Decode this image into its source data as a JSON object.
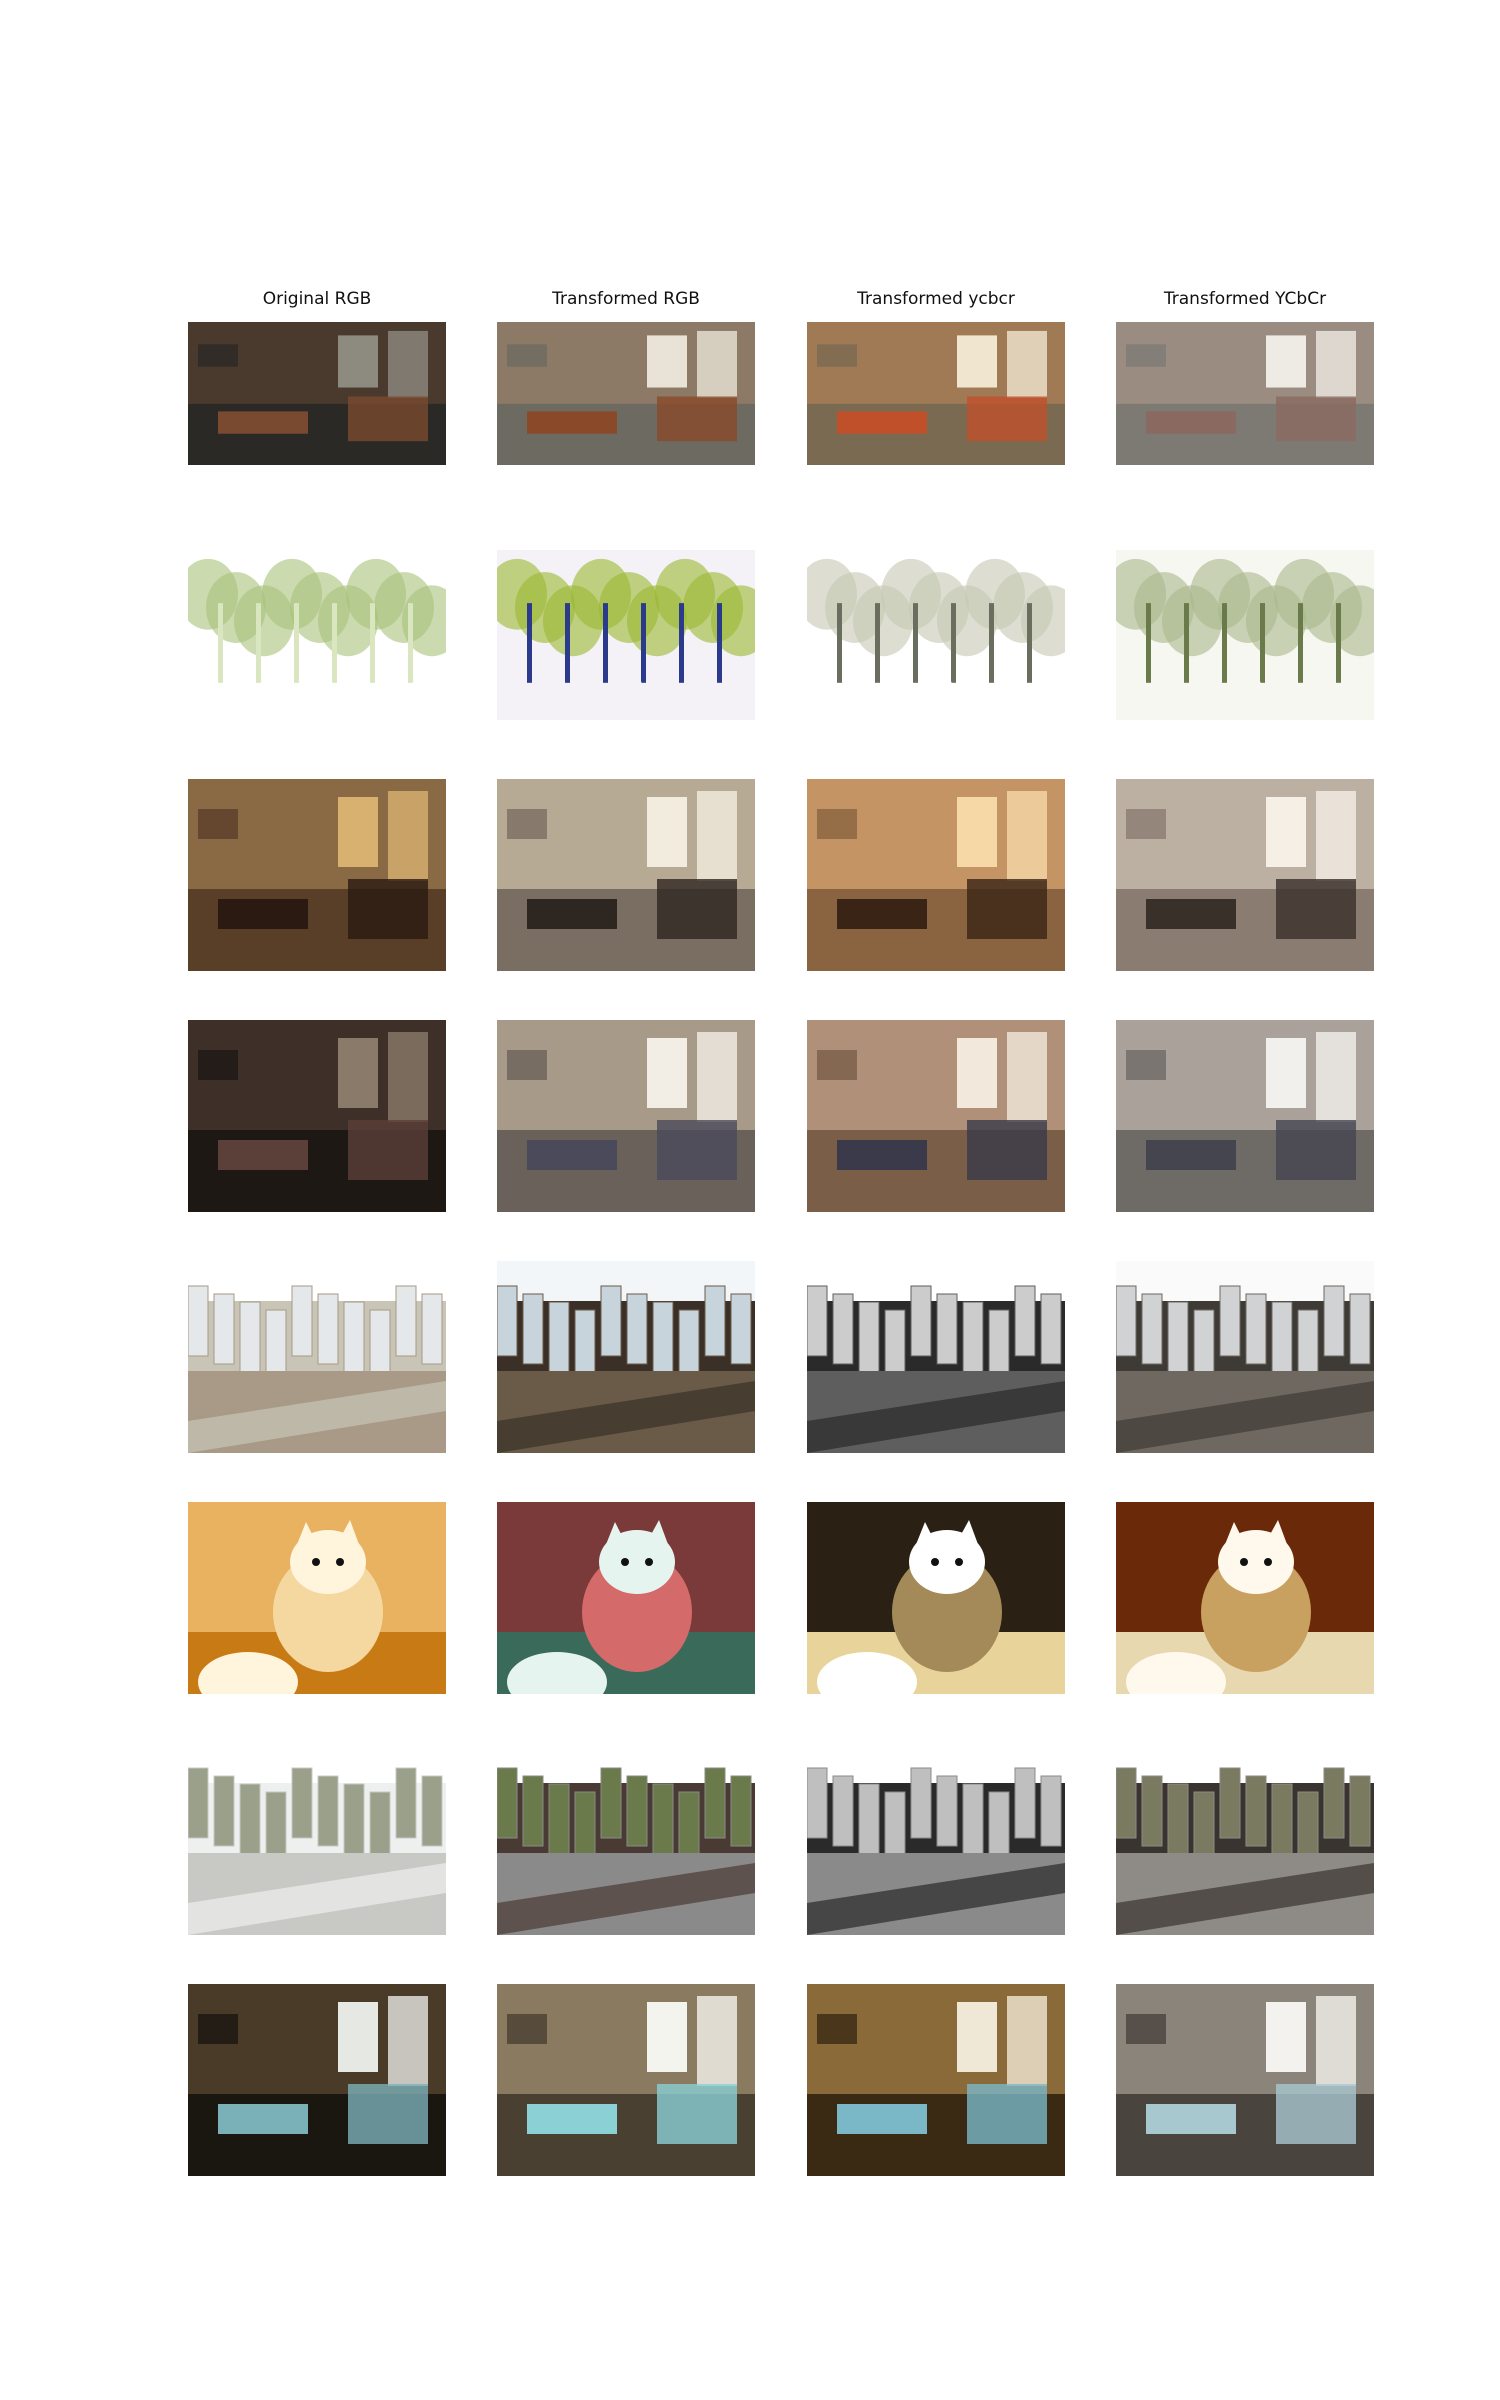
{
  "columns": [
    "Original RGB",
    "Transformed RGB",
    "Transformed ycbcr",
    "Transformed YCbCr"
  ],
  "rows": [
    {
      "scene": "living-room-dark-tv",
      "variants": [
        {
          "bg": "#2b2926",
          "mid": "#4a3a2e",
          "accent": "#7a4a30",
          "light": "#8d8a7f"
        },
        {
          "bg": "#6d6a62",
          "mid": "#8c7a66",
          "accent": "#8a4a2a",
          "light": "#e8e3d6"
        },
        {
          "bg": "#7a6a52",
          "mid": "#a07a55",
          "accent": "#c0502a",
          "light": "#f0e6cf"
        },
        {
          "bg": "#7d7a74",
          "mid": "#9a8c80",
          "accent": "#8a6a60",
          "light": "#eeeae4"
        }
      ]
    },
    {
      "scene": "forest-path-bright",
      "variants": [
        {
          "bg": "#eef3e0",
          "mid": "#d9e6bf",
          "accent": "#a9c27a",
          "light": "#ffffff"
        },
        {
          "bg": "#4a5a1a",
          "mid": "#2b3a8a",
          "accent": "#9ab830",
          "light": "#f4f2f7"
        },
        {
          "bg": "#2a2e26",
          "mid": "#6a6e5e",
          "accent": "#c7c8b3",
          "light": "#ffffff"
        },
        {
          "bg": "#3a4a2a",
          "mid": "#6a7a4a",
          "accent": "#a9b88a",
          "light": "#f7f7f2"
        }
      ]
    },
    {
      "scene": "living-room-warm-doors",
      "variants": [
        {
          "bg": "#5a3f28",
          "mid": "#8a6a45",
          "accent": "#2a1a12",
          "light": "#d8b070"
        },
        {
          "bg": "#7a6e62",
          "mid": "#b7aa95",
          "accent": "#2e2620",
          "light": "#f2ecde"
        },
        {
          "bg": "#8a6440",
          "mid": "#c49465",
          "accent": "#3a2415",
          "light": "#f6d7a6"
        },
        {
          "bg": "#8a7c70",
          "mid": "#bcb0a2",
          "accent": "#3a302a",
          "light": "#f5efe6"
        }
      ]
    },
    {
      "scene": "office-room-shadow",
      "variants": [
        {
          "bg": "#1e1814",
          "mid": "#3e3028",
          "accent": "#5a4038",
          "light": "#8a7a6a"
        },
        {
          "bg": "#6a625a",
          "mid": "#a89a88",
          "accent": "#4a4a5a",
          "light": "#f2eee6"
        },
        {
          "bg": "#7a5e48",
          "mid": "#b09078",
          "accent": "#3a3a4a",
          "light": "#f3e8dc"
        },
        {
          "bg": "#6e6a66",
          "mid": "#aaa29a",
          "accent": "#454550",
          "light": "#f2f0ec"
        }
      ]
    },
    {
      "scene": "city-towers-aerial",
      "variants": [
        {
          "bg": "#c8c4b6",
          "mid": "#a89a86",
          "accent": "#e4e8ea",
          "light": "#ffffff"
        },
        {
          "bg": "#3a3028",
          "mid": "#6a5a48",
          "accent": "#c8d4dc",
          "light": "#f2f6f8"
        },
        {
          "bg": "#2a2a2a",
          "mid": "#5e5e5e",
          "accent": "#cccccc",
          "light": "#ffffff"
        },
        {
          "bg": "#3e3a36",
          "mid": "#6e6860",
          "accent": "#d0d2d4",
          "light": "#fafafa"
        }
      ]
    },
    {
      "scene": "kitten-yellow",
      "variants": [
        {
          "bg": "#e8b260",
          "mid": "#f5d8a0",
          "accent": "#c87a14",
          "light": "#fff4dc"
        },
        {
          "bg": "#7a3a3a",
          "mid": "#d46a6a",
          "accent": "#3a6a5a",
          "light": "#e6f4f0"
        },
        {
          "bg": "#2a2014",
          "mid": "#a48a58",
          "accent": "#e8d49a",
          "light": "#ffffff"
        },
        {
          "bg": "#6a2a0a",
          "mid": "#c8a060",
          "accent": "#e8d8b0",
          "light": "#fff8ec"
        }
      ]
    },
    {
      "scene": "rooftops-city-bright",
      "variants": [
        {
          "bg": "#eef0f0",
          "mid": "#c8c8c4",
          "accent": "#9aa08a",
          "light": "#ffffff"
        },
        {
          "bg": "#4a3a34",
          "mid": "#8a8a8a",
          "accent": "#6a7a4a",
          "light": "#ffffff"
        },
        {
          "bg": "#2a2a2a",
          "mid": "#8a8a8a",
          "accent": "#bfbfbf",
          "light": "#ffffff"
        },
        {
          "bg": "#3a3430",
          "mid": "#8e8a86",
          "accent": "#7a7a60",
          "light": "#ffffff"
        }
      ]
    },
    {
      "scene": "bedroom-window",
      "variants": [
        {
          "bg": "#1a1610",
          "mid": "#4a3a28",
          "accent": "#7ab0b8",
          "light": "#e6e8e4"
        },
        {
          "bg": "#4a4032",
          "mid": "#8a7a60",
          "accent": "#8ad0d4",
          "light": "#f4f4ee"
        },
        {
          "bg": "#3a2a14",
          "mid": "#8a6a38",
          "accent": "#7ab8c8",
          "light": "#f0e8d6"
        },
        {
          "bg": "#4a443e",
          "mid": "#8a847a",
          "accent": "#a8c8d0",
          "light": "#f4f2ee"
        }
      ]
    }
  ]
}
